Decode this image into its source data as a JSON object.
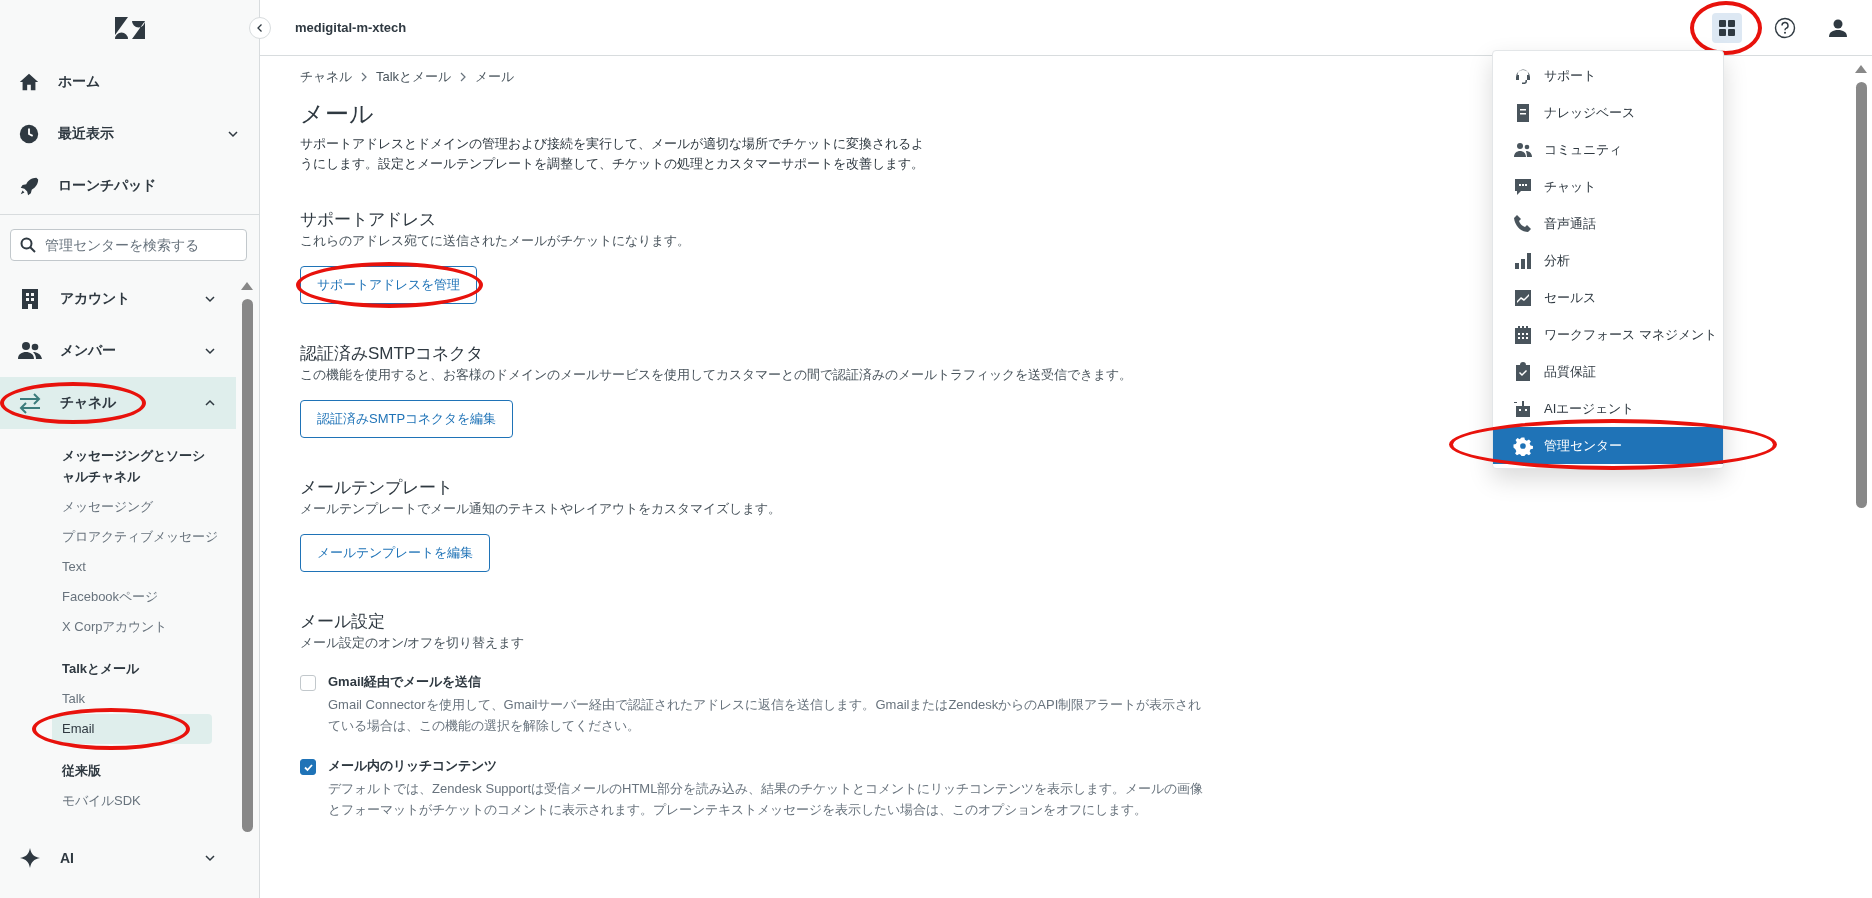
{
  "sidebar": {
    "top_items": [
      {
        "label": "ホーム",
        "kind": "link"
      },
      {
        "label": "最近表示",
        "kind": "group",
        "expanded": false
      },
      {
        "label": "ローンチパッド",
        "kind": "link"
      }
    ],
    "search": {
      "placeholder": "管理センターを検索する"
    },
    "nav_items": [
      {
        "label": "アカウント",
        "expanded": false,
        "selected": false,
        "circled": false
      },
      {
        "label": "メンバー",
        "expanded": false,
        "selected": false,
        "circled": false
      },
      {
        "label": "チャネル",
        "expanded": true,
        "selected": true,
        "circled": true,
        "sections": [
          {
            "heading": "メッセージングとソーシャルチャネル",
            "items": [
              {
                "label": "メッセージング",
                "selected": false,
                "circled": false
              },
              {
                "label": "プロアクティブメッセージ",
                "selected": false,
                "circled": false
              },
              {
                "label": "Text",
                "selected": false,
                "circled": false
              },
              {
                "label": "Facebookページ",
                "selected": false,
                "circled": false
              },
              {
                "label": "X Corpアカウント",
                "selected": false,
                "circled": false
              }
            ]
          },
          {
            "heading": "Talkとメール",
            "items": [
              {
                "label": "Talk",
                "selected": false,
                "circled": false
              },
              {
                "label": "Email",
                "selected": true,
                "circled": true
              }
            ]
          },
          {
            "heading": "従来版",
            "items": [
              {
                "label": "モバイルSDK",
                "selected": false,
                "circled": false
              }
            ]
          }
        ]
      },
      {
        "label": "AI",
        "expanded": false,
        "selected": false,
        "circled": false
      }
    ]
  },
  "top_bar": {
    "account": "medigital-m-xtech",
    "apps_button": {
      "selected": true,
      "circled": true
    }
  },
  "apps_menu": [
    {
      "label": "サポート",
      "selected": false,
      "circled": false
    },
    {
      "label": "ナレッジベース",
      "selected": false,
      "circled": false
    },
    {
      "label": "コミュニティ",
      "selected": false,
      "circled": false
    },
    {
      "label": "チャット",
      "selected": false,
      "circled": false
    },
    {
      "label": "音声通話",
      "selected": false,
      "circled": false
    },
    {
      "label": "分析",
      "selected": false,
      "circled": false
    },
    {
      "label": "セールス",
      "selected": false,
      "circled": false
    },
    {
      "label": "ワークフォース マネジメント",
      "selected": false,
      "circled": false
    },
    {
      "label": "品質保証",
      "selected": false,
      "circled": false
    },
    {
      "label": "AIエージェント",
      "selected": false,
      "circled": false
    },
    {
      "label": "管理センター",
      "selected": true,
      "circled": true
    }
  ],
  "breadcrumb": [
    "チャネル",
    "Talkとメール",
    "メール"
  ],
  "page": {
    "title": "メール",
    "description": "サポートアドレスとドメインの管理および接続を実行して、メールが適切な場所でチケットに変換されるようにします。設定とメールテンプレートを調整して、チケットの処理とカスタマーサポートを改善します。"
  },
  "sections": [
    {
      "title": "サポートアドレス",
      "description": "これらのアドレス宛てに送信されたメールがチケットになります。",
      "button": {
        "label": "サポートアドレスを管理",
        "circled": true
      }
    },
    {
      "title": "認証済みSMTPコネクタ",
      "description": "この機能を使用すると、お客様のドメインのメールサービスを使用してカスタマーとの間で認証済みのメールトラフィックを送受信できます。",
      "button": {
        "label": "認証済みSMTPコネクタを編集",
        "circled": false
      }
    },
    {
      "title": "メールテンプレート",
      "description": "メールテンプレートでメール通知のテキストやレイアウトをカスタマイズします。",
      "button": {
        "label": "メールテンプレートを編集",
        "circled": false
      }
    }
  ],
  "settings": {
    "title": "メール設定",
    "description": "メール設定のオン/オフを切り替えます",
    "options": [
      {
        "label": "Gmail経由でメールを送信",
        "description": "Gmail Connectorを使用して、Gmailサーバー経由で認証されたアドレスに返信を送信します。GmailまたはZendeskからのAPI制限アラートが表示されている場合は、この機能の選択を解除してください。",
        "checked": false
      },
      {
        "label": "メール内のリッチコンテンツ",
        "description": "デフォルトでは、Zendesk Supportは受信メールのHTML部分を読み込み、結果のチケットとコメントにリッチコンテンツを表示します。メールの画像とフォーマットがチケットのコメントに表示されます。プレーンテキストメッセージを表示したい場合は、このオプションをオフにします。",
        "checked": true
      }
    ]
  }
}
